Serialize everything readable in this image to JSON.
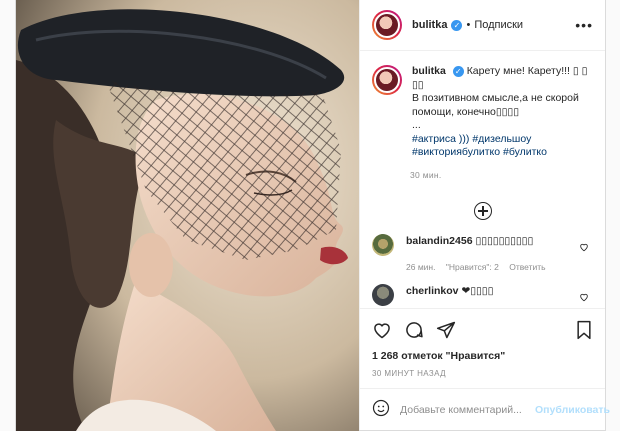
{
  "post": {
    "author": "bulitka",
    "follow_label": "Подписки",
    "dot": "•",
    "more": "•••"
  },
  "caption": {
    "author": "bulitka",
    "line1": "Карету мне! Карету!!! ▯ ▯ ▯▯",
    "line2": "В позитивном смысле,а не скорой помощи, конечно▯▯▯▯",
    "line3": "...",
    "tags": "#актриса ))) #дизельшоу #викториябулитко #булитко",
    "time": "30 мин."
  },
  "comments": [
    {
      "user": "balandin2456",
      "text": "▯▯▯▯▯▯▯▯▯▯",
      "time": "26 мин.",
      "likes": "\"Нравится\": 2",
      "reply": "Ответить"
    },
    {
      "user": "cherlinkov",
      "text": "❤▯▯▯▯"
    }
  ],
  "likes_text": "1 268 отметок \"Нравится\"",
  "post_time": "30 МИНУТ НАЗАД",
  "add_comment": {
    "placeholder": "Добавьте комментарий...",
    "publish": "Опубликовать"
  },
  "colors": {
    "link": "#00376b",
    "muted": "#8e8e8e",
    "publish": "#b2dffc"
  }
}
